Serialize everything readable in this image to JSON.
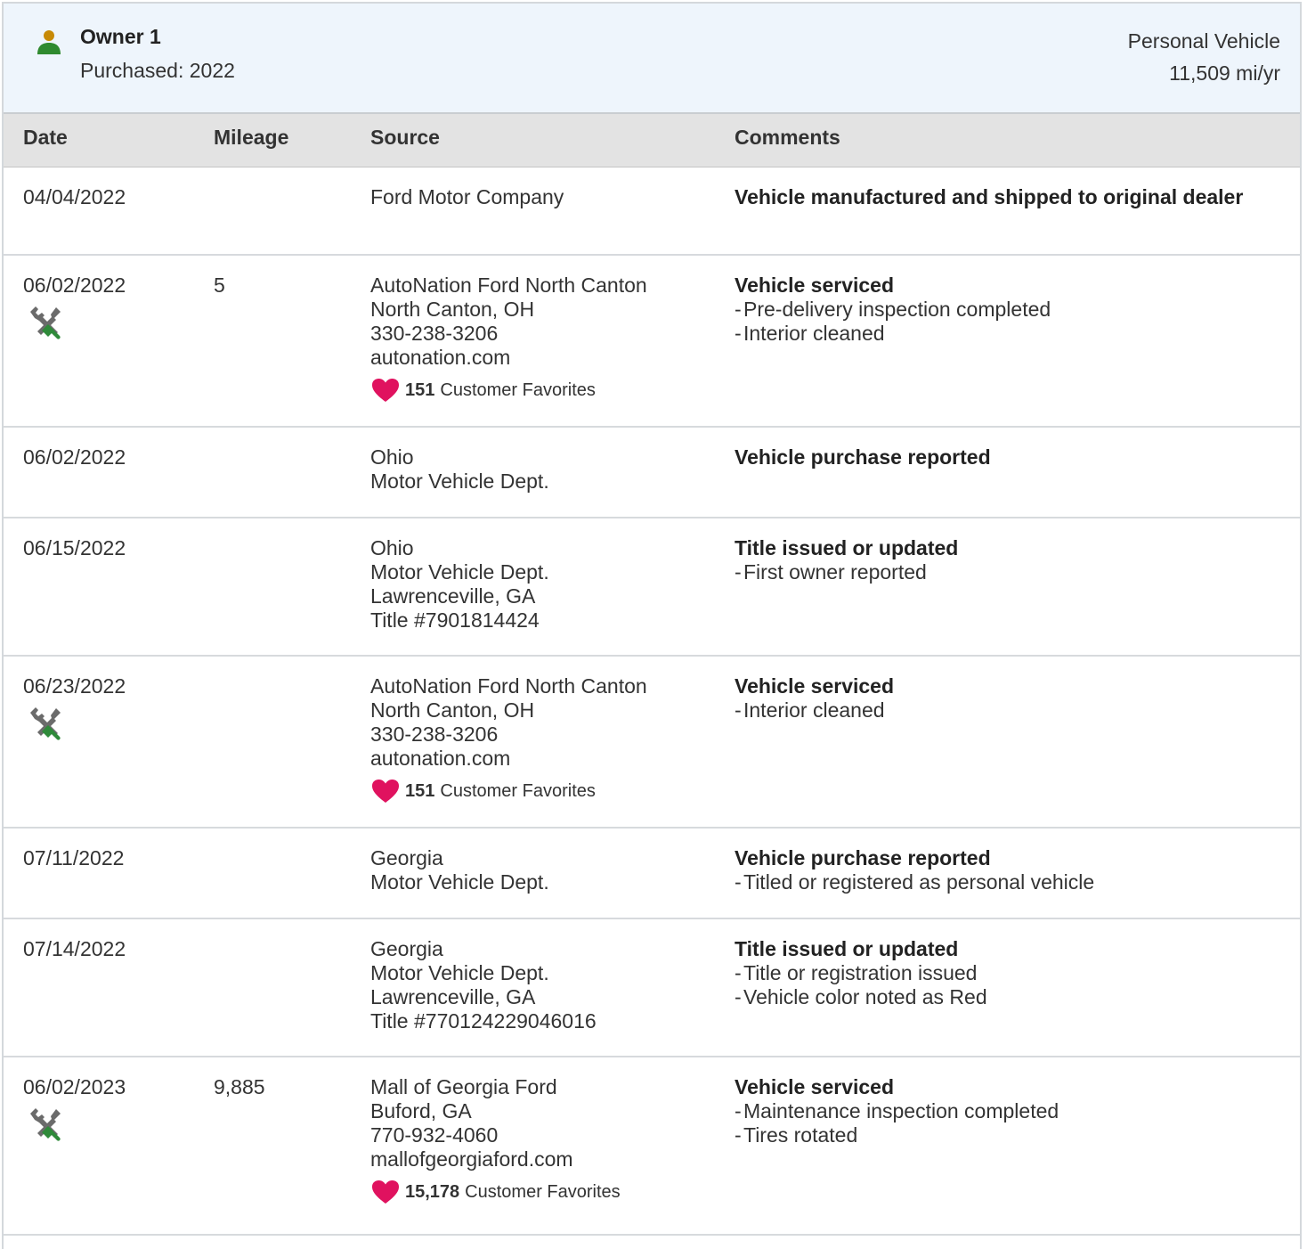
{
  "owner": {
    "title": "Owner 1",
    "purchased": "Purchased: 2022",
    "vehicle_type": "Personal Vehicle",
    "mileage_rate": "11,509 mi/yr",
    "icon": "person-icon",
    "icon_colors": {
      "head": "#c78a06",
      "body": "#2f8a2f"
    }
  },
  "table": {
    "headers": {
      "date": "Date",
      "mileage": "Mileage",
      "source": "Source",
      "comments": "Comments"
    },
    "rows": [
      {
        "date": "04/04/2022",
        "mileage": "",
        "source": [
          "Ford Motor Company"
        ],
        "headline": "Vehicle manufactured and shipped to original dealer",
        "details": []
      },
      {
        "date": "06/02/2022",
        "service_icon": "wrench-screwdriver-icon",
        "mileage": "5",
        "source": [
          "AutoNation Ford North Canton",
          "North Canton, OH",
          "330-238-3206",
          "autonation.com"
        ],
        "favorites": {
          "count": "151",
          "label": "Customer Favorites",
          "icon": "heart-icon"
        },
        "headline": "Vehicle serviced",
        "details": [
          "Pre-delivery inspection completed",
          "Interior cleaned"
        ]
      },
      {
        "date": "06/02/2022",
        "mileage": "",
        "source": [
          "Ohio",
          "Motor Vehicle Dept."
        ],
        "headline": "Vehicle purchase reported",
        "details": []
      },
      {
        "date": "06/15/2022",
        "mileage": "",
        "source": [
          "Ohio",
          "Motor Vehicle Dept.",
          "Lawrenceville, GA",
          "Title #7901814424"
        ],
        "headline": "Title issued or updated",
        "details": [
          "First owner reported"
        ]
      },
      {
        "date": "06/23/2022",
        "service_icon": "wrench-screwdriver-icon",
        "mileage": "",
        "source": [
          "AutoNation Ford North Canton",
          "North Canton, OH",
          "330-238-3206",
          "autonation.com"
        ],
        "favorites": {
          "count": "151",
          "label": "Customer Favorites",
          "icon": "heart-icon"
        },
        "headline": "Vehicle serviced",
        "details": [
          "Interior cleaned"
        ]
      },
      {
        "date": "07/11/2022",
        "mileage": "",
        "source": [
          "Georgia",
          "Motor Vehicle Dept."
        ],
        "headline": "Vehicle purchase reported",
        "details": [
          "Titled or registered as personal vehicle"
        ]
      },
      {
        "date": "07/14/2022",
        "mileage": "",
        "source": [
          "Georgia",
          "Motor Vehicle Dept.",
          "Lawrenceville, GA",
          "Title #770124229046016"
        ],
        "headline": "Title issued or updated",
        "details": [
          "Title or registration issued",
          "Vehicle color noted as Red"
        ]
      },
      {
        "date": "06/02/2023",
        "service_icon": "wrench-screwdriver-icon",
        "mileage": "9,885",
        "source": [
          "Mall of Georgia Ford",
          "Buford, GA",
          "770-932-4060",
          "mallofgeorgiaford.com"
        ],
        "favorites": {
          "count": "15,178",
          "label": "Customer Favorites",
          "icon": "heart-icon"
        },
        "headline": "Vehicle serviced",
        "details": [
          "Maintenance inspection completed",
          "Tires rotated"
        ]
      }
    ]
  },
  "colors": {
    "header_bg": "#eef5fc",
    "column_header_bg": "#e3e3e3",
    "heart": "#e0125f",
    "tool_gray": "#6b6b6b",
    "tool_green": "#2f8a3a"
  }
}
